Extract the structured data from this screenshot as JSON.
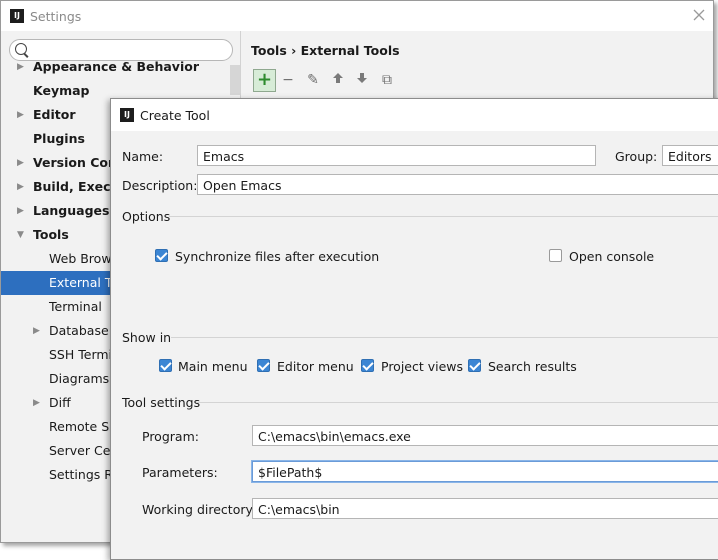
{
  "settings": {
    "title": "Settings",
    "app_icon": "IJ",
    "close_glyph": "╲╱",
    "search": {
      "value": "",
      "placeholder": ""
    },
    "tree": [
      {
        "label": "Appearance & Behavior",
        "bold": true,
        "arrow": "▶"
      },
      {
        "label": "Keymap",
        "bold": true,
        "arrow": ""
      },
      {
        "label": "Editor",
        "bold": true,
        "arrow": "▶"
      },
      {
        "label": "Plugins",
        "bold": true,
        "arrow": ""
      },
      {
        "label": "Version Control",
        "bold": true,
        "arrow": "▶"
      },
      {
        "label": "Build, Execution, Deployment",
        "bold": true,
        "arrow": "▶"
      },
      {
        "label": "Languages & Frameworks",
        "bold": true,
        "arrow": "▶"
      },
      {
        "label": "Tools",
        "bold": true,
        "arrow": "▼"
      },
      {
        "label": "Web Browsers",
        "bold": false,
        "arrow": ""
      },
      {
        "label": "External Tools",
        "bold": false,
        "arrow": "",
        "selected": true
      },
      {
        "label": "Terminal",
        "bold": false,
        "arrow": ""
      },
      {
        "label": "Database",
        "bold": false,
        "arrow": "▶"
      },
      {
        "label": "SSH Terminal",
        "bold": false,
        "arrow": ""
      },
      {
        "label": "Diagrams",
        "bold": false,
        "arrow": ""
      },
      {
        "label": "Diff",
        "bold": false,
        "arrow": "▶"
      },
      {
        "label": "Remote SSH External Tools",
        "bold": false,
        "arrow": ""
      },
      {
        "label": "Server Certificates",
        "bold": false,
        "arrow": ""
      },
      {
        "label": "Settings Repository",
        "bold": false,
        "arrow": ""
      }
    ],
    "breadcrumb": "Tools › External Tools",
    "toolbar": {
      "add": "+",
      "remove": "−",
      "edit": "✎",
      "up": "🡑",
      "down": "🡓",
      "copy": "⧉"
    }
  },
  "dialog": {
    "title": "Create Tool",
    "app_icon": "IJ",
    "name_label": "Name:",
    "name_value": "Emacs",
    "group_label": "Group:",
    "group_value": "Editors",
    "description_label": "Description:",
    "description_value": "Open Emacs",
    "options_heading": "Options",
    "sync_label": "Synchronize files after execution",
    "sync_checked": true,
    "console_label": "Open console",
    "console_checked": false,
    "show_in_heading": "Show in",
    "show_in": [
      {
        "label": "Main menu",
        "checked": true
      },
      {
        "label": "Editor menu",
        "checked": true
      },
      {
        "label": "Project views",
        "checked": true
      },
      {
        "label": "Search results",
        "checked": true
      }
    ],
    "tool_settings_heading": "Tool settings",
    "program_label": "Program:",
    "program_value": "C:\\emacs\\bin\\emacs.exe",
    "parameters_label": "Parameters:",
    "parameters_value": "$FilePath$",
    "working_dir_label": "Working directory:",
    "working_dir_value": "C:\\emacs\\bin"
  }
}
